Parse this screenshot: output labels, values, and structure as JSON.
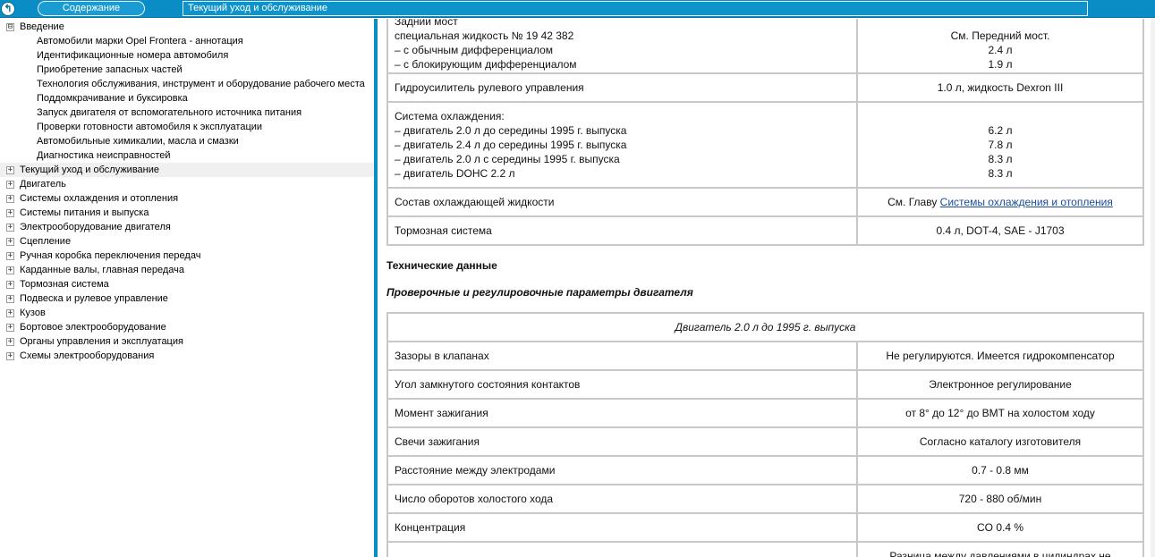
{
  "header": {
    "back_icon_glyph": "↰",
    "contents_label": "Содержание",
    "title": "Текущий уход и обслуживание"
  },
  "sidebar": {
    "items": [
      {
        "label": "Введение",
        "expander": "⊟",
        "level": 0
      },
      {
        "label": "Автомобили  марки Opel Frontera - аннотация",
        "level": 1
      },
      {
        "label": "Идентификационные номера автомобиля",
        "level": 1
      },
      {
        "label": "Приобретение запасных частей",
        "level": 1
      },
      {
        "label": "Технология обслуживания, инструмент и оборудование рабочего места",
        "level": 1
      },
      {
        "label": "Поддомкрачивание и буксировка",
        "level": 1
      },
      {
        "label": "Запуск двигателя от вспомогательного источника питания",
        "level": 1
      },
      {
        "label": "Проверки готовности автомобиля к эксплуатации",
        "level": 1
      },
      {
        "label": "Автомобильные химикалии, масла и смазки",
        "level": 1
      },
      {
        "label": "Диагностика неисправностей",
        "level": 1
      },
      {
        "label": "Текущий уход и обслуживание",
        "expander": "+",
        "level": 0,
        "selected": true
      },
      {
        "label": "Двигатель",
        "expander": "+",
        "level": 0
      },
      {
        "label": "Системы охлаждения и отопления",
        "expander": "+",
        "level": 0
      },
      {
        "label": "Системы питания и выпуска",
        "expander": "+",
        "level": 0
      },
      {
        "label": "Электрооборудование двигателя",
        "expander": "+",
        "level": 0
      },
      {
        "label": "Сцепление",
        "expander": "+",
        "level": 0
      },
      {
        "label": "Ручная коробка переключения передач",
        "expander": "+",
        "level": 0
      },
      {
        "label": "Карданные валы, главная передача",
        "expander": "+",
        "level": 0
      },
      {
        "label": "Тормозная система",
        "expander": "+",
        "level": 0
      },
      {
        "label": "Подвеска и рулевое управление",
        "expander": "+",
        "level": 0
      },
      {
        "label": "Кузов",
        "expander": "+",
        "level": 0
      },
      {
        "label": "Бортовое электрооборудование",
        "expander": "+",
        "level": 0
      },
      {
        "label": "Органы управления и эксплуатация",
        "expander": "+",
        "level": 0
      },
      {
        "label": "Схемы электрооборудования",
        "expander": "+",
        "level": 0
      }
    ]
  },
  "table1": {
    "rows": [
      {
        "left": [
          "Задний мост",
          "специальная жидкость № 19 42 382",
          "– с обычным дифференциалом",
          "– с блокирующим дифференциалом"
        ],
        "right": [
          "",
          "См. Передний мост.",
          "2.4 л",
          "1.9 л"
        ]
      },
      {
        "left": [
          "Гидроусилитель рулевого управления"
        ],
        "right": [
          "1.0 л, жидкость Dexron III"
        ]
      },
      {
        "left": [
          "Система охлаждения:",
          "– двигатель 2.0 л до середины 1995 г. выпуска",
          "– двигатель 2.4 л до середины 1995 г. выпуска",
          "– двигатель 2.0 л с середины 1995 г. выпуска",
          "– двигатель DOHC 2.2 л"
        ],
        "right": [
          "",
          "6.2 л",
          "7.8 л",
          "8.3 л",
          "8.3 л"
        ]
      },
      {
        "left": [
          "Состав охлаждающей жидкости"
        ],
        "right_prefix": "См. Главу ",
        "right_link": "Системы охлаждения и отопления"
      },
      {
        "left": [
          "Тормозная система"
        ],
        "right": [
          "0.4 л, DOT-4, SAE - J1703"
        ]
      }
    ]
  },
  "section_title": "Технические данные",
  "subsection_title": "Проверочные и регулировочные параметры двигателя",
  "table2": {
    "caption": "Двигатель 2.0 л до 1995 г. выпуска",
    "rows": [
      [
        "Зазоры в клапанах",
        "Не регулируются. Имеется гидрокомпенсатор"
      ],
      [
        "Угол замкнутого состояния контактов",
        "Электронное регулирование"
      ],
      [
        "Момент зажигания",
        "от 8° до 12° до ВМТ на холостом ходу"
      ],
      [
        "Свечи зажигания",
        "Согласно каталогу изготовителя"
      ],
      [
        "Расстояние между электродами",
        "0.7 - 0.8 мм"
      ],
      [
        "Число оборотов холостого хода",
        "720 - 880 об/мин"
      ],
      [
        "Концентрация",
        "CO 0.4 %"
      ],
      [
        "",
        "Разница между давлениями в цилиндрах не"
      ]
    ]
  },
  "colors": {
    "accent": "#0a8cc4",
    "link": "#1a4c98",
    "border": "#c8c8c8"
  }
}
